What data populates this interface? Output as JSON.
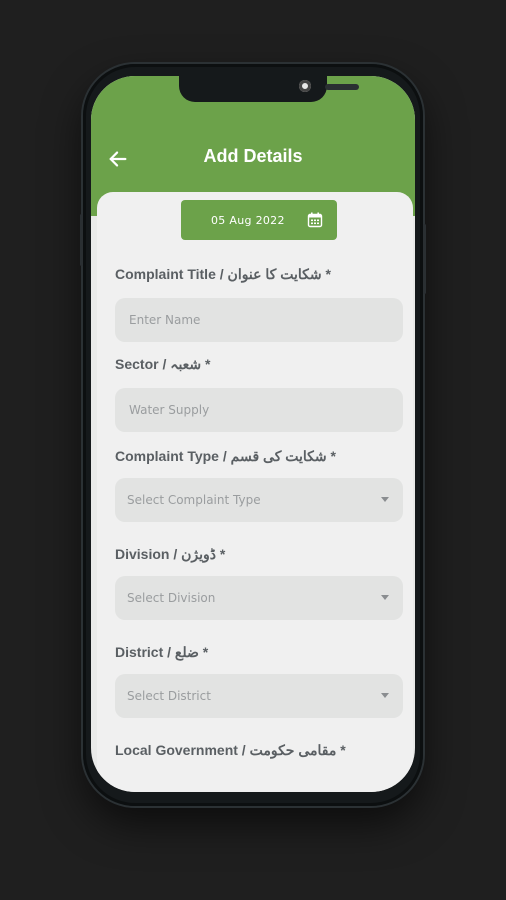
{
  "header": {
    "title": "Add Details"
  },
  "date": {
    "value": "05 Aug 2022"
  },
  "fields": {
    "complaint_title": {
      "label": "Complaint Title / شکایت کا عنوان *",
      "placeholder": "Enter Name"
    },
    "sector": {
      "label": "Sector / شعبہ *",
      "value": "Water Supply"
    },
    "complaint_type": {
      "label": "Complaint Type / شکایت کی قسم *",
      "value": "Select Complaint Type"
    },
    "division": {
      "label": "Division / ڈویژن *",
      "value": "Select Division"
    },
    "district": {
      "label": "District / ضلع *",
      "value": "Select District"
    },
    "local_government": {
      "label": "Local Government / مقامی حکومت *"
    }
  },
  "colors": {
    "brand_green": "#6ca24a",
    "background": "#1f1f1f"
  },
  "icons": {
    "back": "arrow-left-icon",
    "calendar": "calendar-icon",
    "dropdown": "chevron-down-icon"
  }
}
